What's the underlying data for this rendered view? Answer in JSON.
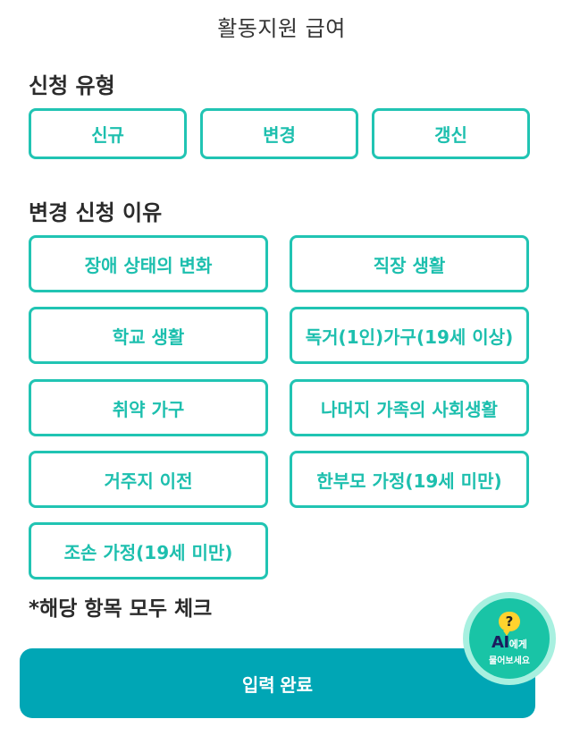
{
  "header": {
    "title": "활동지원 급여"
  },
  "application_type": {
    "title": "신청 유형",
    "options": [
      {
        "label": "신규"
      },
      {
        "label": "변경"
      },
      {
        "label": "갱신"
      }
    ]
  },
  "change_reason": {
    "title": "변경 신청 이유",
    "options": [
      {
        "label": "장애 상태의 변화"
      },
      {
        "label": "직장 생활"
      },
      {
        "label": "학교 생활"
      },
      {
        "label": "독거(1인)가구(19세 이상)"
      },
      {
        "label": "취약 가구"
      },
      {
        "label": "나머지 가족의 사회생활"
      },
      {
        "label": "거주지 이전"
      },
      {
        "label": "한부모 가정(19세 미만)"
      },
      {
        "label": "조손 가정(19세 미만)"
      }
    ]
  },
  "note": "*해당 항목 모두 체크",
  "submit": {
    "label": "입력 완료"
  },
  "ai_helper": {
    "icon": "question-mark-icon",
    "icon_glyph": "?",
    "brand": "AI",
    "suffix": "에게",
    "subtitle": "물어보세요"
  },
  "colors": {
    "accent": "#21c4b3",
    "submit_bg": "#00a6b5",
    "fab": "#19c4a6",
    "bubble": "#ffd22e"
  }
}
